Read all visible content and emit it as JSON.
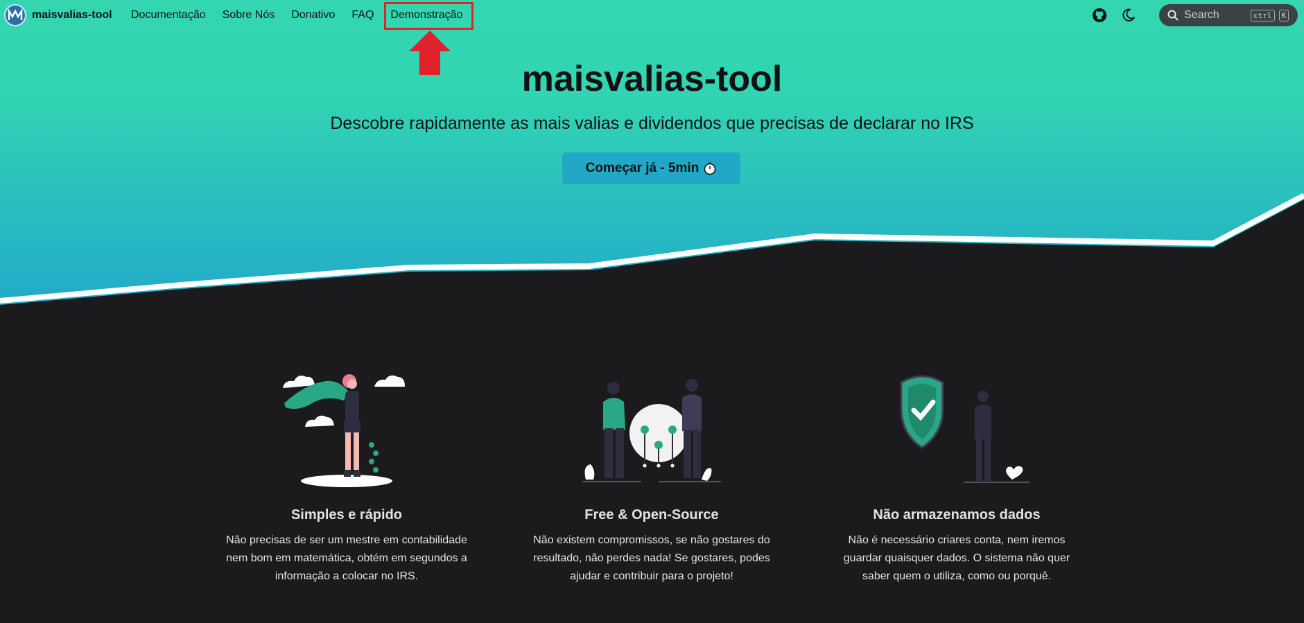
{
  "nav": {
    "brand": "maisvalias-tool",
    "links": [
      "Documentação",
      "Sobre Nós",
      "Donativo",
      "FAQ",
      "Demonstração"
    ],
    "search_placeholder": "Search",
    "search_kbd": [
      "ctrl",
      "K"
    ]
  },
  "hero": {
    "title": "maisvalias-tool",
    "subtitle": "Descobre rapidamente as mais valias e dividendos que precisas de declarar no IRS",
    "cta_label": "Começar já - 5min"
  },
  "features": [
    {
      "title": "Simples e rápido",
      "text": "Não precisas de ser um mestre em contabilidade nem bom em matemática, obtém em segundos a informação a colocar no IRS."
    },
    {
      "title": "Free & Open-Source",
      "text": "Não existem compromissos, se não gostares do resultado, não perdes nada! Se gostares, podes ajudar e contribuir para o projeto!"
    },
    {
      "title": "Não armazenamos dados",
      "text": "Não é necessário criares conta, nem iremos guardar quaisquer dados. O sistema não quer saber quem o utiliza, como ou porquê."
    }
  ],
  "colors": {
    "hero_top": "#33d6b0",
    "hero_bottom": "#21a9c9",
    "dark_bg": "#1b1b1d",
    "accent_green": "#2aa785",
    "annotation_red": "#e0222a"
  },
  "icons": [
    "logo-icon",
    "github-icon",
    "moon-icon",
    "search-icon",
    "timer-icon"
  ]
}
